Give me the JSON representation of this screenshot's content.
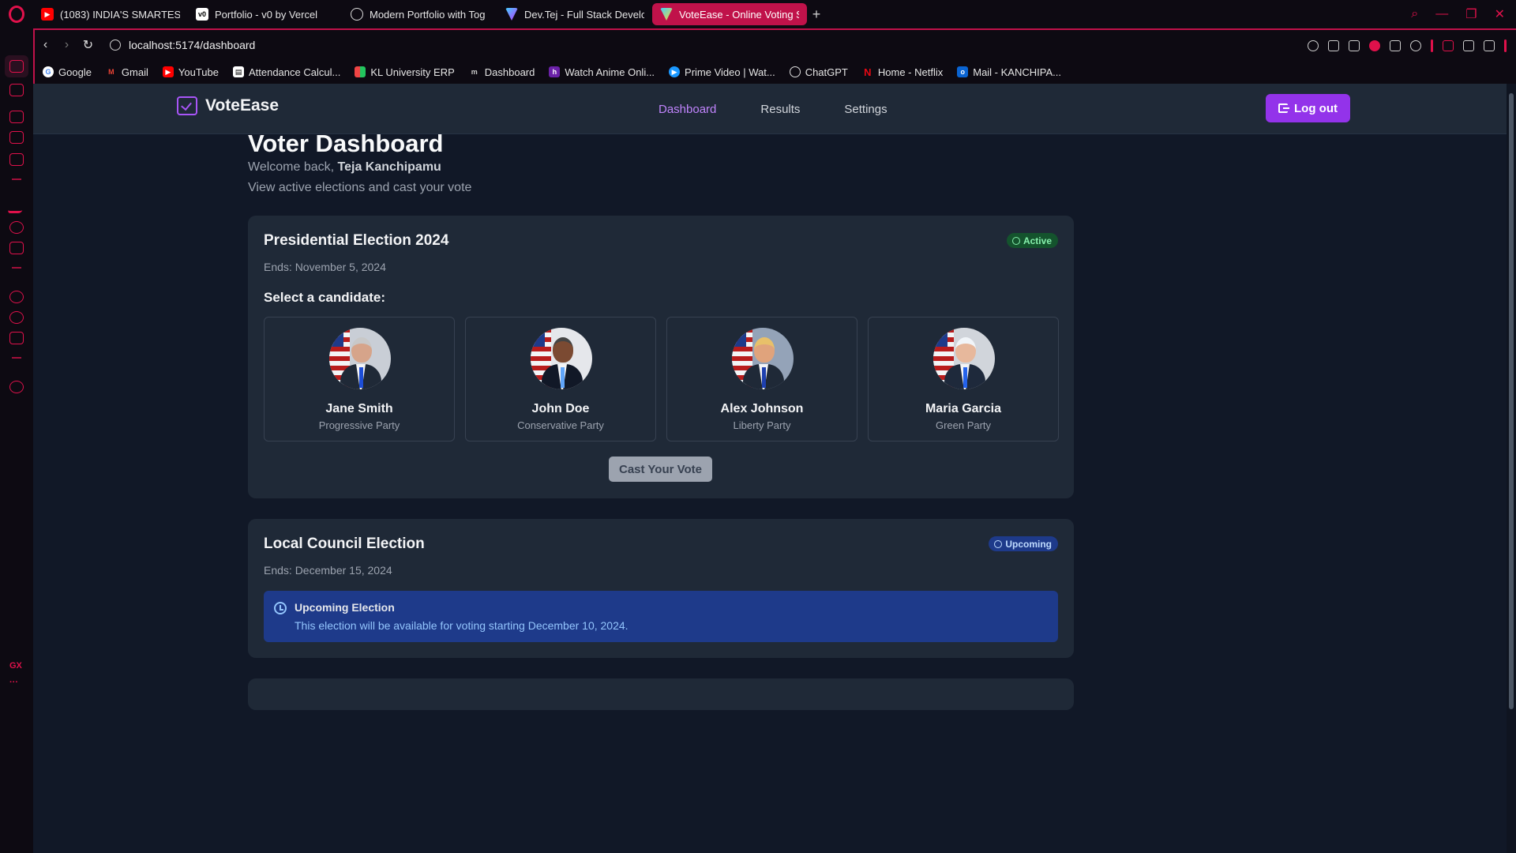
{
  "browser": {
    "tabs": [
      {
        "label": "(1083) INDIA'S SMARTEST",
        "icon": "youtube-icon",
        "color": "#ff0000"
      },
      {
        "label": "Portfolio - v0 by Vercel",
        "icon": "v0-icon",
        "color": "#ffffff"
      },
      {
        "label": "Modern Portfolio with Tog",
        "icon": "chatgpt-icon",
        "color": "#dddddd"
      },
      {
        "label": "Dev.Tej - Full Stack Develo",
        "icon": "vite-icon",
        "color": "#a855f7"
      },
      {
        "label": "VoteEase - Online Voting S",
        "icon": "vite-icon",
        "color": "#a855f7"
      }
    ],
    "url": "localhost:5174/dashboard",
    "bookmarks": [
      {
        "label": "Google",
        "icon": "google-icon",
        "color": "#4285f4"
      },
      {
        "label": "Gmail",
        "icon": "gmail-icon",
        "color": "#ea4335"
      },
      {
        "label": "YouTube",
        "icon": "youtube-icon",
        "color": "#ff0000"
      },
      {
        "label": "Attendance Calcul...",
        "icon": "calculator-icon",
        "color": "#ffffff"
      },
      {
        "label": "KL University ERP",
        "icon": "erp-icon",
        "color": "#f59e0b"
      },
      {
        "label": "Dashboard",
        "icon": "dashboard-icon",
        "color": "#cccccc"
      },
      {
        "label": "Watch Anime Onli...",
        "icon": "anime-icon",
        "color": "#6b21a8"
      },
      {
        "label": "Prime Video | Wat...",
        "icon": "prime-video-icon",
        "color": "#1a98ff"
      },
      {
        "label": "ChatGPT",
        "icon": "chatgpt-icon",
        "color": "#dddddd"
      },
      {
        "label": "Home - Netflix",
        "icon": "netflix-icon",
        "color": "#e50914"
      },
      {
        "label": "Mail - KANCHIPA...",
        "icon": "outlook-icon",
        "color": "#0a64d2"
      }
    ],
    "accent": "#c0124a"
  },
  "app": {
    "brand": "VoteEase",
    "nav": [
      "Dashboard",
      "Results",
      "Settings"
    ],
    "active_nav": "Dashboard",
    "logout": "Log out",
    "accent": "#9333ea"
  },
  "page": {
    "title": "Voter Dashboard",
    "welcome_prefix": "Welcome back, ",
    "user_name": "Teja Kanchipamu",
    "subtitle": "View active elections and cast your vote"
  },
  "elections": [
    {
      "title": "Presidential Election 2024",
      "ends": "Ends: November 5, 2024",
      "status": "Active",
      "select_label": "Select a candidate:",
      "candidates": [
        {
          "name": "Jane Smith",
          "party": "Progressive Party"
        },
        {
          "name": "John Doe",
          "party": "Conservative Party"
        },
        {
          "name": "Alex Johnson",
          "party": "Liberty Party"
        },
        {
          "name": "Maria Garcia",
          "party": "Green Party"
        }
      ],
      "button": "Cast Your Vote"
    },
    {
      "title": "Local Council Election",
      "ends": "Ends: December 15, 2024",
      "status": "Upcoming",
      "notice_title": "Upcoming Election",
      "notice_text": "This election will be available for voting starting December 10, 2024."
    }
  ]
}
